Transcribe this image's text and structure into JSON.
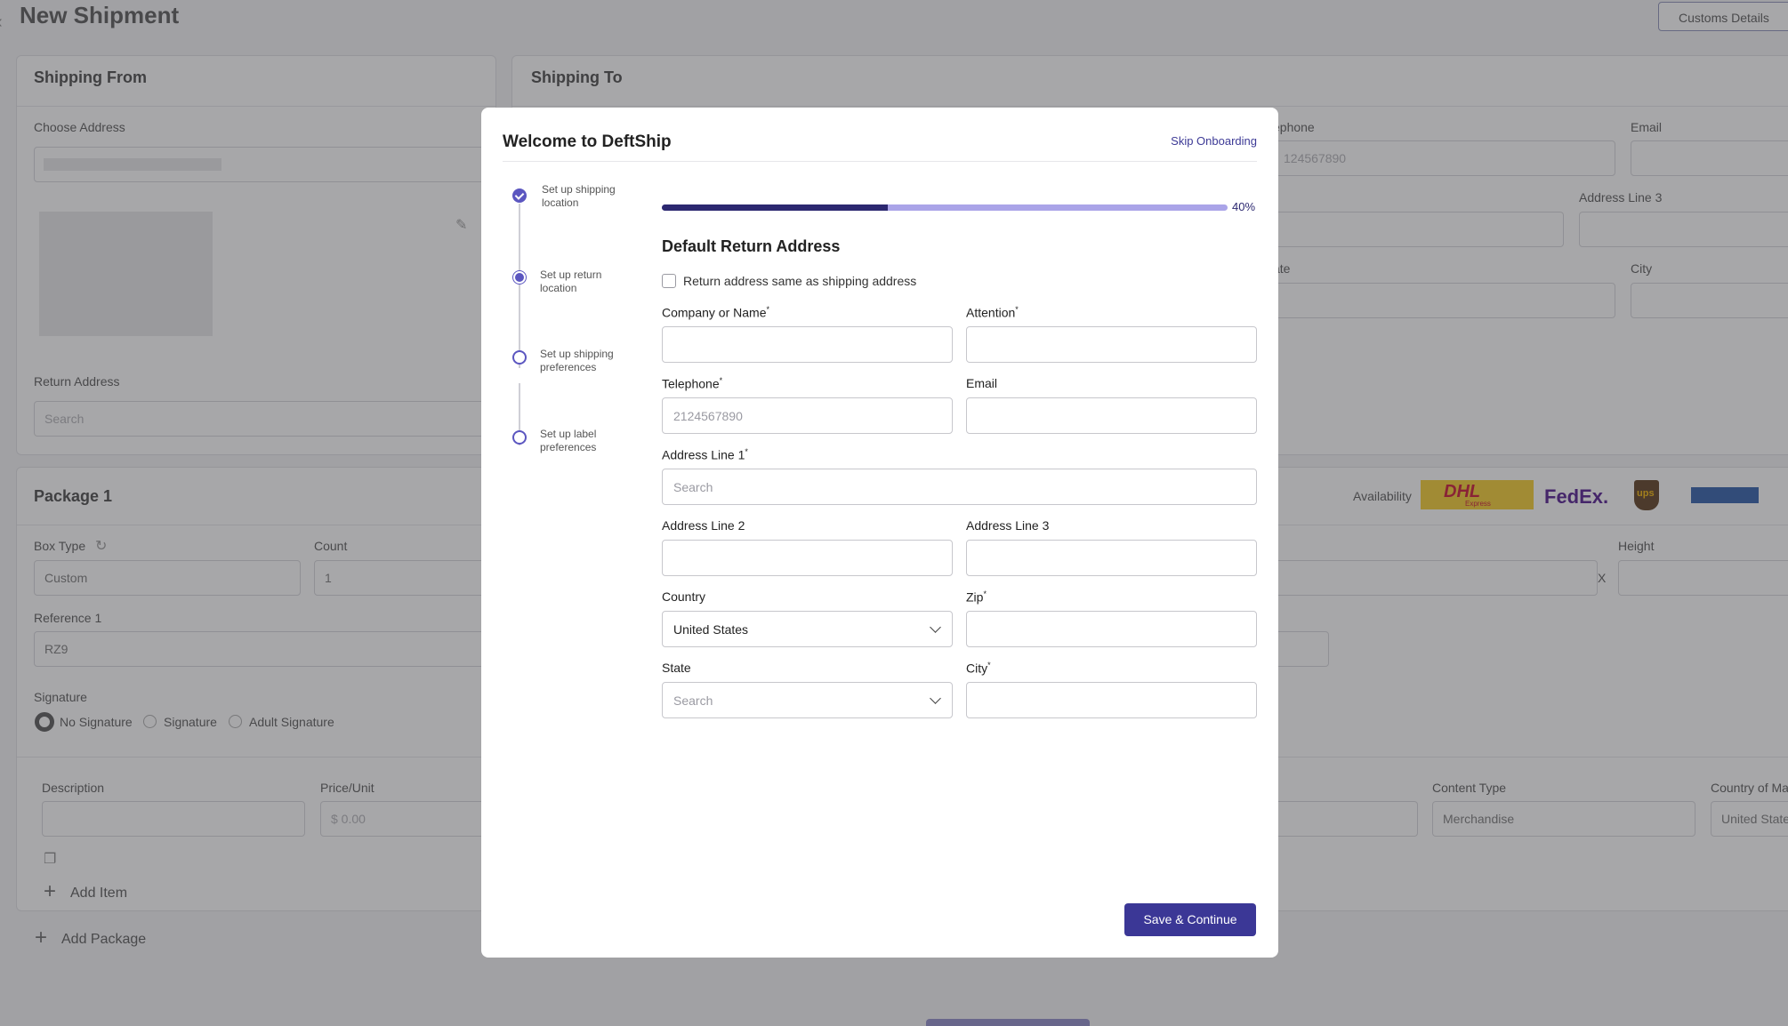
{
  "background": {
    "page_title": "New Shipment",
    "customs_button": "Customs Details",
    "shipping_from": {
      "title": "Shipping From",
      "choose_address_label": "Choose Address",
      "return_address_label": "Return Address",
      "return_address_placeholder": "Search"
    },
    "shipping_to": {
      "title": "Shipping To",
      "telephone_label": "ephone",
      "telephone_placeholder": "124567890",
      "email_label": "Email",
      "address_line3_label": "Address Line 3",
      "state_label": "ate",
      "city_label": "City"
    },
    "package": {
      "title": "Package 1",
      "availability_label": "Availability",
      "box_type_label": "Box Type",
      "box_type_value": "Custom",
      "count_label": "Count",
      "count_value": "1",
      "height_label": "Height",
      "x_label": "X",
      "reference_label": "Reference 1",
      "reference_value": "RZ9",
      "signature_label": "Signature",
      "signature_options": [
        "No Signature",
        "Signature",
        "Adult Signature"
      ],
      "description_label": "Description",
      "price_label": "Price/Unit",
      "price_placeholder": "$  0.00",
      "content_type_label": "Content Type",
      "content_type_value": "Merchandise",
      "country_of_label": "Country of Ma",
      "country_of_value": "United State",
      "add_item": "Add Item",
      "add_package": "Add Package"
    },
    "carriers": [
      "DHL",
      "Express",
      "FedEx.",
      "ups"
    ]
  },
  "modal": {
    "title": "Welcome to DeftShip",
    "skip_link": "Skip Onboarding",
    "steps": [
      {
        "label": "Set up shipping location",
        "state": "done"
      },
      {
        "label": "Set up return location",
        "state": "active"
      },
      {
        "label": "Set up shipping preferences",
        "state": "todo"
      },
      {
        "label": "Set up label preferences",
        "state": "todo"
      }
    ],
    "progress": {
      "value": 40,
      "label": "40%"
    },
    "section_title": "Default Return Address",
    "same_as_shipping": {
      "label": "Return address same as shipping address",
      "checked": false
    },
    "fields": {
      "company": {
        "label": "Company or Name",
        "required": true,
        "value": ""
      },
      "attention": {
        "label": "Attention",
        "required": true,
        "value": ""
      },
      "telephone": {
        "label": "Telephone",
        "required": true,
        "placeholder": "2124567890"
      },
      "email": {
        "label": "Email",
        "required": false,
        "value": ""
      },
      "address1": {
        "label": "Address Line 1",
        "required": true,
        "placeholder": "Search"
      },
      "address2": {
        "label": "Address Line 2",
        "required": false,
        "value": ""
      },
      "address3": {
        "label": "Address Line 3",
        "required": false,
        "value": ""
      },
      "country": {
        "label": "Country",
        "required": false,
        "value": "United States"
      },
      "zip": {
        "label": "Zip",
        "required": true,
        "value": ""
      },
      "state": {
        "label": "State",
        "required": false,
        "placeholder": "Search"
      },
      "city": {
        "label": "City",
        "required": true,
        "value": ""
      }
    },
    "save_button": "Save & Continue"
  },
  "colors": {
    "accent": "#3b3796",
    "progress_fill": "#2c2870",
    "progress_track": "#aaa4e8",
    "overlay": "rgba(60,60,64,0.45)"
  }
}
